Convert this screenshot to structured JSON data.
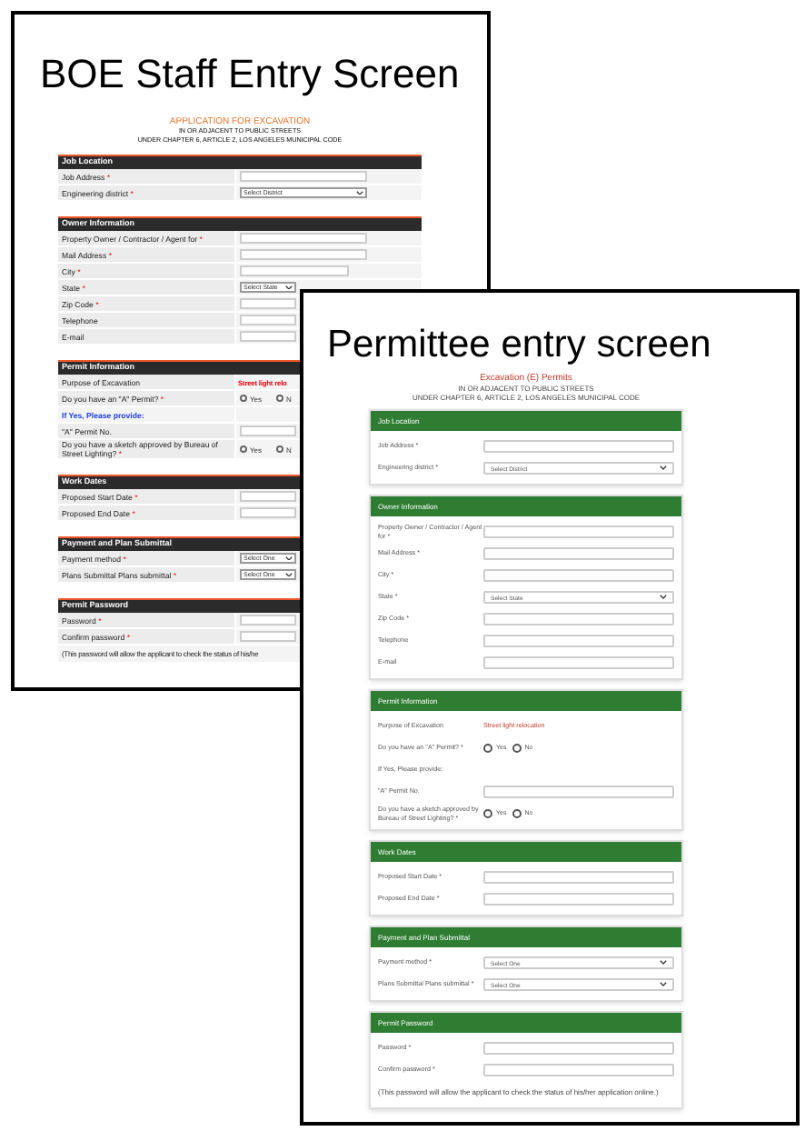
{
  "staff_screen": {
    "kind": "classic",
    "heading": "BOE Staff Entry Screen",
    "form": {
      "title": "APPLICATION FOR EXCAVATION",
      "subtitle_lines": [
        "IN OR ADJACENT TO PUBLIC STREETS",
        "UNDER CHAPTER 6, ARTICLE 2, LOS ANGELES MUNICIPAL CODE"
      ],
      "sections": [
        {
          "title": "Job Location",
          "rows": [
            {
              "kind": "input",
              "label": "Job Address",
              "mark": "*"
            },
            {
              "kind": "select",
              "label": "Engineering district",
              "mark": "*",
              "value": "Select District"
            }
          ]
        },
        {
          "title": "Owner Information",
          "rows": [
            {
              "kind": "input",
              "label": "Property Owner / Contractor / Agent for",
              "mark": "*"
            },
            {
              "kind": "input",
              "label": "Mail Address",
              "mark": "*"
            },
            {
              "kind": "input",
              "label": "City",
              "mark": "*"
            },
            {
              "kind": "select",
              "label": "State",
              "mark": "*",
              "value": "Select State"
            },
            {
              "kind": "input",
              "label": "Zip Code",
              "mark": "*"
            },
            {
              "kind": "input",
              "label": "Telephone"
            },
            {
              "kind": "input",
              "label": "E-mail"
            }
          ]
        },
        {
          "title": "Permit Information",
          "rows": [
            {
              "kind": "static",
              "label": "Purpose of Excavation",
              "value": "Street light relo"
            },
            {
              "kind": "radio",
              "label": "Do you have an \"A\" Permit?",
              "mark": "*",
              "options": [
                {
                  "label": "Yes",
                  "selected": false
                },
                {
                  "label": "N",
                  "selected": false
                }
              ]
            },
            {
              "kind": "hint",
              "label": "If Yes, Please provide:"
            },
            {
              "kind": "input",
              "label": "\"A\" Permit No."
            },
            {
              "kind": "radio",
              "label": "Do you have a sketch approved by Bureau of Street Lighting?",
              "mark": "*",
              "options": [
                {
                  "label": "Yes",
                  "selected": false
                },
                {
                  "label": "N",
                  "selected": false
                }
              ]
            }
          ]
        },
        {
          "title": "Work Dates",
          "rows": [
            {
              "kind": "input",
              "label": "Proposed Start Date",
              "mark": "*"
            },
            {
              "kind": "input",
              "label": "Proposed End Date",
              "mark": "*"
            }
          ]
        },
        {
          "title": "Payment and Plan Submittal",
          "rows": [
            {
              "kind": "select",
              "label": "Payment method",
              "mark": "*",
              "value": "Select One"
            },
            {
              "kind": "select",
              "label": "Plans Submittal Plans submittal",
              "mark": "*",
              "value": "Select One"
            }
          ]
        },
        {
          "title": "Permit Password",
          "rows": [
            {
              "kind": "input",
              "label": "Password",
              "mark": "*"
            },
            {
              "kind": "input",
              "label": "Confirm password",
              "mark": "*"
            },
            {
              "kind": "note",
              "label": "(This password will allow the applicant to check the status of his/he"
            }
          ]
        }
      ]
    }
  },
  "permittee_screen": {
    "kind": "material",
    "heading": "Permittee entry screen",
    "form": {
      "title": "Excavation (E) Permits",
      "subtitle_lines": [
        "IN OR ADJACENT TO PUBLIC STREETS",
        "UNDER CHAPTER 6, ARTICLE 2, LOS ANGELES MUNICIPAL CODE"
      ],
      "sections": [
        {
          "title": "Job Location",
          "rows": [
            {
              "kind": "input",
              "label": "Job Address",
              "mark": "*"
            },
            {
              "kind": "select",
              "label": "Engineering district",
              "mark": "*",
              "value": "Select District"
            }
          ]
        },
        {
          "title": "Owner Information",
          "rows": [
            {
              "kind": "input",
              "label": "Property Owner / Contractor / Agent for",
              "mark": "*"
            },
            {
              "kind": "input",
              "label": "Mail Address",
              "mark": "*"
            },
            {
              "kind": "input",
              "label": "City",
              "mark": "*"
            },
            {
              "kind": "select",
              "label": "State",
              "mark": "*",
              "value": "Select State"
            },
            {
              "kind": "input",
              "label": "Zip Code",
              "mark": "*"
            },
            {
              "kind": "input",
              "label": "Telephone"
            },
            {
              "kind": "input",
              "label": "E-mail"
            }
          ]
        },
        {
          "title": "Permit Information",
          "rows": [
            {
              "kind": "static",
              "label": "Purpose of Excavation",
              "value": "Street light relocation"
            },
            {
              "kind": "radio",
              "label": "Do you have an \"A\" Permit?",
              "mark": "*",
              "options": [
                {
                  "label": "Yes",
                  "selected": false
                },
                {
                  "label": "No",
                  "selected": false
                }
              ]
            },
            {
              "kind": "hint",
              "label": "If Yes, Please provide:"
            },
            {
              "kind": "input",
              "label": "\"A\" Permit No."
            },
            {
              "kind": "radio",
              "label": "Do you have a sketch approved by Bureau of Street Lighting?",
              "mark": "*",
              "options": [
                {
                  "label": "Yes",
                  "selected": false
                },
                {
                  "label": "No",
                  "selected": false
                }
              ]
            }
          ]
        },
        {
          "title": "Work Dates",
          "rows": [
            {
              "kind": "input",
              "label": "Proposed Start Date",
              "mark": "*"
            },
            {
              "kind": "input",
              "label": "Proposed End Date",
              "mark": "*"
            }
          ]
        },
        {
          "title": "Payment and Plan Submittal",
          "rows": [
            {
              "kind": "select",
              "label": "Payment method",
              "mark": "*",
              "value": "Select One"
            },
            {
              "kind": "select",
              "label": "Plans Submittal Plans submittal",
              "mark": "*",
              "value": "Select One"
            }
          ]
        },
        {
          "title": "Permit Password",
          "rows": [
            {
              "kind": "input",
              "label": "Password",
              "mark": "*"
            },
            {
              "kind": "input",
              "label": "Confirm password",
              "mark": "*"
            },
            {
              "kind": "note",
              "label": "(This password will allow the applicant to check the status of his/her application online.)"
            }
          ]
        }
      ]
    }
  }
}
